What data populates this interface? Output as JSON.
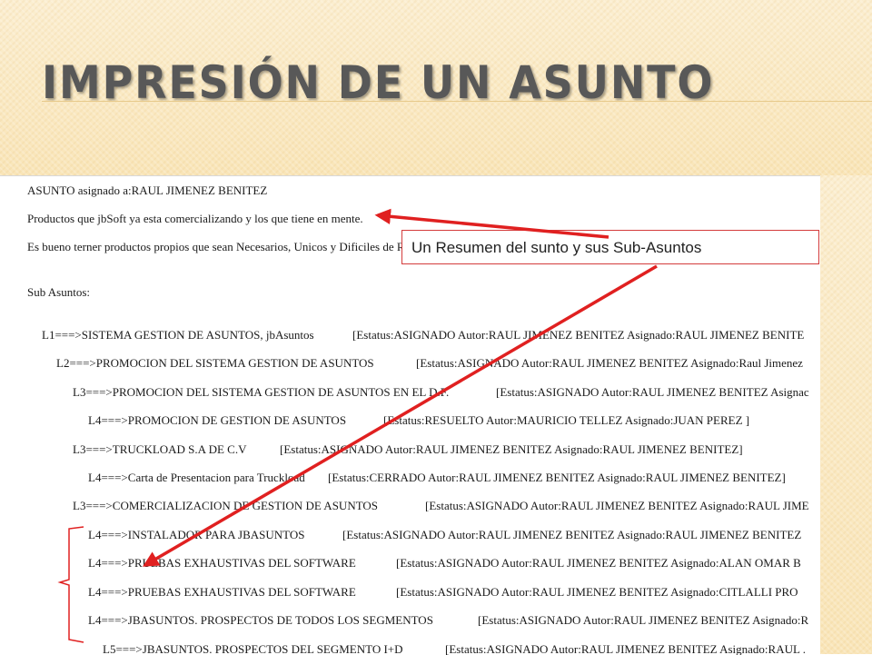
{
  "slide": {
    "title": "Impresión de un asunto"
  },
  "document": {
    "header_lines": [
      "ASUNTO asignado a:RAUL JIMENEZ BENITEZ",
      "Productos que jbSoft ya esta comercializando y los que tiene en mente.",
      "Es bueno terner productos propios que sean Necesarios, Unicos y Dificiles de Replica",
      "Sub Asuntos:"
    ],
    "rows": [
      {
        "name": "L1===>SISTEMA GESTION DE ASUNTOS, jbAsuntos",
        "status": "[Estatus:ASIGNADO Autor:RAUL JIMENEZ BENITEZ Asignado:RAUL JIMENEZ BENITE"
      },
      {
        "name": "L2===>PROMOCION DEL SISTEMA GESTION DE ASUNTOS",
        "status": "[Estatus:ASIGNADO Autor:RAUL JIMENEZ BENITEZ Asignado:Raul Jimenez"
      },
      {
        "name": "L3===>PROMOCION DEL SISTEMA GESTION DE ASUNTOS EN EL D.F.",
        "status": "[Estatus:ASIGNADO Autor:RAUL JIMENEZ BENITEZ Asignac"
      },
      {
        "name": "L4===>PROMOCION DE GESTION DE ASUNTOS",
        "status": "[Estatus:RESUELTO Autor:MAURICIO TELLEZ  Asignado:JUAN PEREZ ]"
      },
      {
        "name": "L3===>TRUCKLOAD S.A DE C.V",
        "status": "[Estatus:ASIGNADO Autor:RAUL JIMENEZ BENITEZ Asignado:RAUL JIMENEZ BENITEZ]"
      },
      {
        "name": "L4===>Carta de Presentacion para Truckload",
        "status": "[Estatus:CERRADO Autor:RAUL JIMENEZ BENITEZ Asignado:RAUL JIMENEZ BENITEZ]"
      },
      {
        "name": "L3===>COMERCIALIZACION DE GESTION DE ASUNTOS",
        "status": "[Estatus:ASIGNADO Autor:RAUL JIMENEZ BENITEZ Asignado:RAUL JIME"
      },
      {
        "name": "L4===>INSTALADOR PARA JBASUNTOS",
        "status": "[Estatus:ASIGNADO Autor:RAUL JIMENEZ BENITEZ Asignado:RAUL JIMENEZ BENITEZ"
      },
      {
        "name": "L4===>PRUEBAS EXHAUSTIVAS DEL SOFTWARE",
        "status": "[Estatus:ASIGNADO Autor:RAUL JIMENEZ BENITEZ Asignado:ALAN OMAR B"
      },
      {
        "name": "L4===>PRUEBAS EXHAUSTIVAS DEL SOFTWARE",
        "status": "[Estatus:ASIGNADO Autor:RAUL JIMENEZ BENITEZ Asignado:CITLALLI PRO"
      },
      {
        "name": "L4===>JBASUNTOS. PROSPECTOS DE TODOS LOS SEGMENTOS",
        "status": "[Estatus:ASIGNADO Autor:RAUL JIMENEZ BENITEZ Asignado:R"
      },
      {
        "name": "L5===>JBASUNTOS. PROSPECTOS DEL SEGMENTO I+D",
        "status": "[Estatus:ASIGNADO Autor:RAUL JIMENEZ BENITEZ Asignado:RAUL ."
      }
    ]
  },
  "callout": {
    "text": "Un Resumen del sunto y sus Sub-Asuntos"
  },
  "colors": {
    "accent_band": "#fbecc9",
    "title_text": "#585858",
    "arrow": "#e02020"
  },
  "icons": [
    "red-arrow-icon",
    "brace-bracket-icon"
  ]
}
